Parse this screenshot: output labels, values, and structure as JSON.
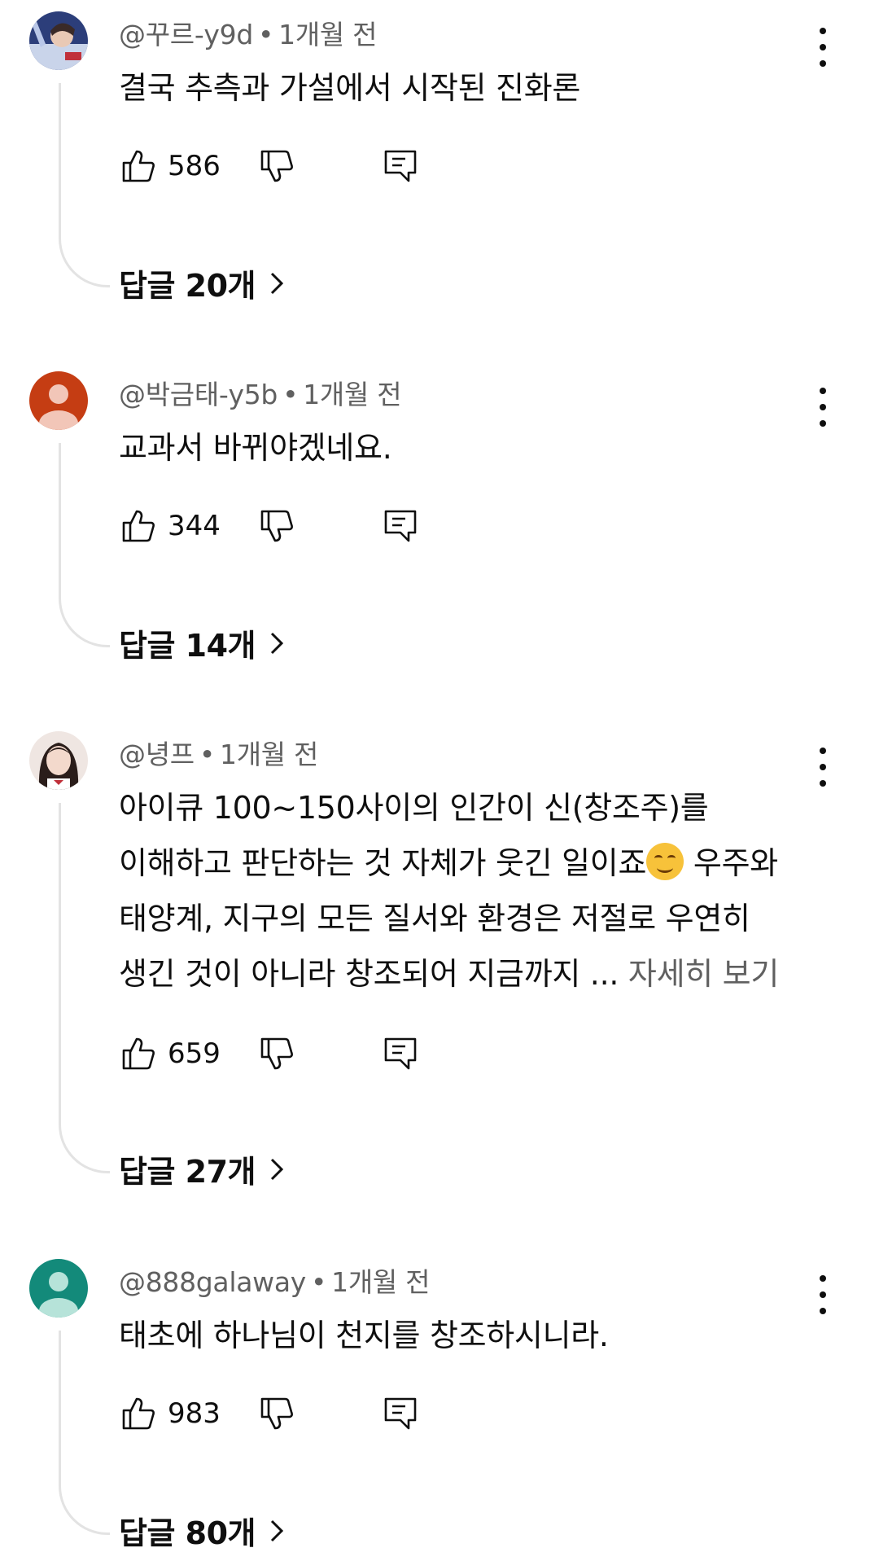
{
  "comments": [
    {
      "author": "@꾸르-y9d",
      "time": "1개월 전",
      "text_lines": [
        "결국 추측과 가설에서 시작된 진화론"
      ],
      "more": "",
      "likes": "586",
      "replies_label": "답글 20개",
      "avatar_icon": "profile-photo-icon"
    },
    {
      "author": "@박금태-y5b",
      "time": "1개월 전",
      "text_lines": [
        "교과서 바뀌야겠네요."
      ],
      "more": "",
      "likes": "344",
      "replies_label": "답글 14개",
      "avatar_icon": "default-avatar-icon",
      "avatar_color": "#c53d13"
    },
    {
      "author": "@녕프",
      "time": "1개월 전",
      "text_lines": [
        "아이큐 100~150사이의 인간이 신(창조주)를",
        "이해하고 판단하는 것 자체가 웃긴 일이죠",
        " 우주와",
        "태양계, 지구의 모든 질서와 환경은 저절로 우연히",
        "생긴 것이 아니라 창조되어 지금까지 ... "
      ],
      "more": "자세히 보기",
      "likes": "659",
      "replies_label": "답글 27개",
      "avatar_icon": "profile-photo-icon"
    },
    {
      "author": "@888galaway",
      "time": "1개월 전",
      "text_lines": [
        "태초에 하나님이 천지를 창조하시니라."
      ],
      "more": "",
      "likes": "983",
      "replies_label": "답글 80개",
      "avatar_icon": "default-avatar-icon",
      "avatar_color": "#138a7a"
    }
  ],
  "icons": {
    "like": "thumbs-up-icon",
    "dislike": "thumbs-down-icon",
    "reply": "reply-icon",
    "more": "more-vert-icon",
    "chevron": "chevron-right-icon",
    "emoji": "smiling-face-emoji"
  },
  "separator": "•"
}
